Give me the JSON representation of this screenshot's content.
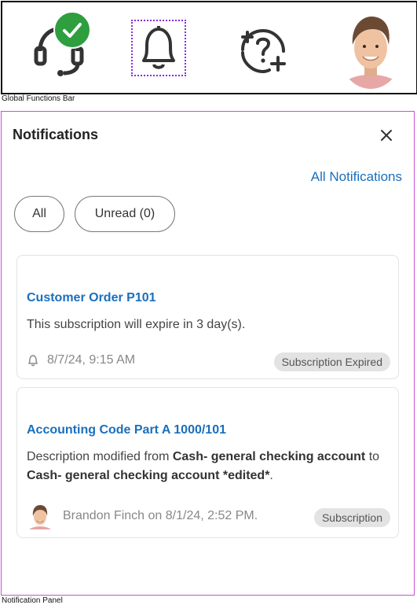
{
  "global_bar": {
    "caption": "Global Functions Bar",
    "icons": [
      "headset-icon",
      "status-check-icon",
      "bell-icon",
      "help-add-icon",
      "user-avatar"
    ]
  },
  "panel": {
    "caption": "Notification Panel",
    "title": "Notifications",
    "all_notifications_link": "All Notifications",
    "filters": {
      "all": "All",
      "unread": "Unread (0)"
    },
    "cards": [
      {
        "title": "Customer Order P101",
        "body": "This subscription will expire in 3 day(s).",
        "meta": "8/7/24, 9:15 AM",
        "tag": "Subscription Expired"
      },
      {
        "title": "Accounting Code Part A 1000/101",
        "body_prefix": "Description modified from ",
        "body_old": "Cash- general checking account",
        "body_mid": " to ",
        "body_new": "Cash- general checking account *edited*",
        "body_suffix": ".",
        "meta": "Brandon Finch on 8/1/24, 2:52 PM.",
        "tag": "Subscription"
      }
    ]
  },
  "colors": {
    "link": "#1a6fbd",
    "status_green": "#2e9e3f",
    "panel_border": "#c84fd8",
    "focus_outline": "#8a2be2"
  }
}
